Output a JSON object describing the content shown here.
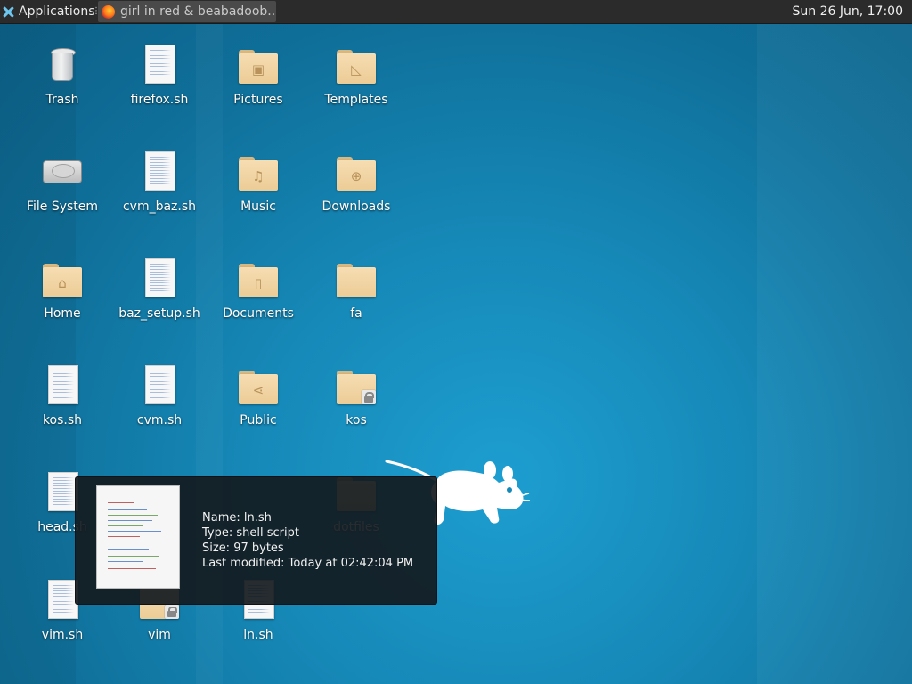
{
  "panel": {
    "applications_label": "Applications",
    "task_title": "girl in red & beabadoob...",
    "clock": "Sun 26 Jun, 17:00"
  },
  "desktop_icons": [
    {
      "label": "Trash",
      "icon": "trash-icon"
    },
    {
      "label": "firefox.sh",
      "icon": "shell-script-icon"
    },
    {
      "label": "Pictures",
      "icon": "folder-pictures-icon"
    },
    {
      "label": "Templates",
      "icon": "folder-templates-icon"
    },
    {
      "label": "File System",
      "icon": "drive-icon"
    },
    {
      "label": "cvm_baz.sh",
      "icon": "shell-script-icon"
    },
    {
      "label": "Music",
      "icon": "folder-music-icon"
    },
    {
      "label": "Downloads",
      "icon": "folder-downloads-icon"
    },
    {
      "label": "Home",
      "icon": "folder-home-icon"
    },
    {
      "label": "baz_setup.sh",
      "icon": "shell-script-icon"
    },
    {
      "label": "Documents",
      "icon": "folder-documents-icon"
    },
    {
      "label": "fa",
      "icon": "folder-icon"
    },
    {
      "label": "kos.sh",
      "icon": "shell-script-icon"
    },
    {
      "label": "cvm.sh",
      "icon": "shell-script-icon"
    },
    {
      "label": "Public",
      "icon": "folder-public-icon"
    },
    {
      "label": "kos",
      "icon": "folder-locked-icon"
    },
    {
      "label": "head.sh",
      "icon": "shell-script-icon"
    },
    {
      "label": "dotfiles",
      "icon": "folder-icon"
    },
    {
      "label": "vim.sh",
      "icon": "shell-script-icon"
    },
    {
      "label": "vim",
      "icon": "folder-locked-icon"
    },
    {
      "label": "ln.sh",
      "icon": "shell-script-icon"
    }
  ],
  "tooltip": {
    "name": "Name: ln.sh",
    "type": "Type: shell script",
    "size": "Size: 97 bytes",
    "modified": "Last modified: Today at 02:42:04 PM"
  },
  "colors": {
    "panel_bg": "#2b2b2b",
    "wallpaper": "#1689b8",
    "folder": "#eccc96"
  }
}
